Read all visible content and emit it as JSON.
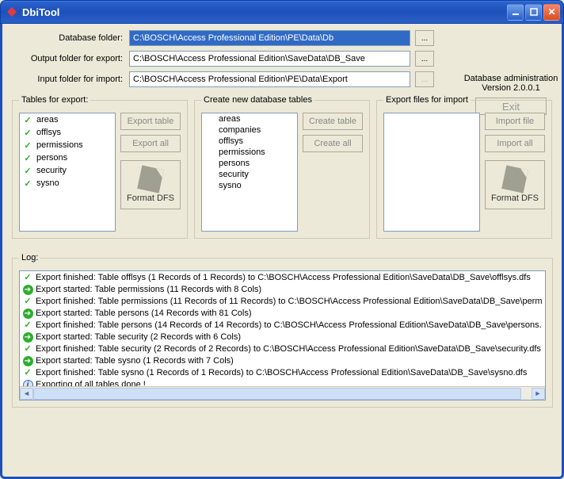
{
  "window": {
    "title": "DbiTool"
  },
  "paths": {
    "db_folder_label": "Database folder:",
    "db_folder_value": "C:\\BOSCH\\Access Professional Edition\\PE\\Data\\Db",
    "output_label": "Output folder for export:",
    "output_value": "C:\\BOSCH\\Access Professional Edition\\SaveData\\DB_Save",
    "input_label": "Input folder for import:",
    "input_value": "C:\\BOSCH\\Access Professional Edition\\PE\\Data\\Export",
    "browse": "..."
  },
  "admin": {
    "line1": "Database administration",
    "line2": "Version 2.0.0.1",
    "exit": "Exit"
  },
  "export_panel": {
    "legend": "Tables for export:",
    "items": [
      "areas",
      "offlsys",
      "permissions",
      "persons",
      "security",
      "sysno"
    ],
    "btn_one": "Export table",
    "btn_all": "Export all",
    "format": "Format DFS"
  },
  "create_panel": {
    "legend": "Create new database tables",
    "items": [
      "areas",
      "companies",
      "offlsys",
      "permissions",
      "persons",
      "security",
      "sysno"
    ],
    "btn_one": "Create table",
    "btn_all": "Create all"
  },
  "import_panel": {
    "legend": "Export files for import",
    "btn_one": "Import file",
    "btn_all": "Import all",
    "format": "Format DFS"
  },
  "log": {
    "legend": "Log:",
    "lines": [
      {
        "t": "check",
        "text": "Export finished: Table offlsys (1 Records of 1 Records) to C:\\BOSCH\\Access Professional Edition\\SaveData\\DB_Save\\offlsys.dfs"
      },
      {
        "t": "arrow",
        "text": "Export started: Table permissions (11 Records with 8 Cols)"
      },
      {
        "t": "check",
        "text": "Export finished: Table permissions (11 Records of 11 Records) to C:\\BOSCH\\Access Professional Edition\\SaveData\\DB_Save\\perm"
      },
      {
        "t": "arrow",
        "text": "Export started: Table persons (14 Records with 81 Cols)"
      },
      {
        "t": "check",
        "text": "Export finished: Table persons (14 Records of 14 Records) to C:\\BOSCH\\Access Professional Edition\\SaveData\\DB_Save\\persons."
      },
      {
        "t": "arrow",
        "text": "Export started: Table security (2 Records with 6 Cols)"
      },
      {
        "t": "check",
        "text": "Export finished: Table security (2 Records of 2 Records) to C:\\BOSCH\\Access Professional Edition\\SaveData\\DB_Save\\security.dfs"
      },
      {
        "t": "arrow",
        "text": "Export started: Table sysno (1 Records with 7 Cols)"
      },
      {
        "t": "check",
        "text": "Export finished: Table sysno (1 Records of 1 Records) to C:\\BOSCH\\Access Professional Edition\\SaveData\\DB_Save\\sysno.dfs"
      },
      {
        "t": "info",
        "text": "Exporting of all tables done !"
      }
    ]
  }
}
